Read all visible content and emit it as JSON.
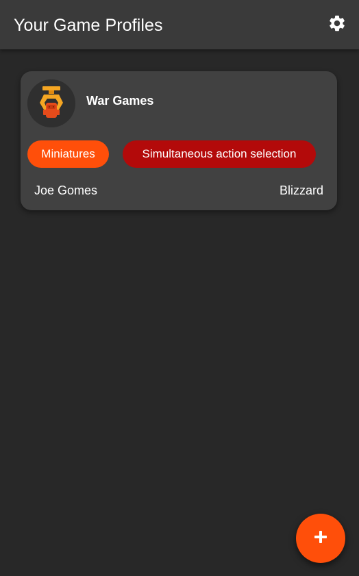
{
  "appbar": {
    "title": "Your Game Profiles",
    "settings_icon": "gear-icon"
  },
  "games": [
    {
      "title": "War Games",
      "avatar_icon": "medal-crane-icon",
      "tags": [
        {
          "label": "Miniatures",
          "color": "#ff4f0a"
        },
        {
          "label": "Simultaneous action selection",
          "color": "#b30a0a"
        }
      ],
      "designer": "Joe Gomes",
      "publisher": "Blizzard"
    }
  ],
  "fab": {
    "icon": "plus-icon",
    "color": "#ff4f0a"
  },
  "colors": {
    "background": "#282828",
    "appbar": "#3a3a3a",
    "card": "#414141",
    "accent": "#ff4f0a",
    "tag_secondary": "#b30a0a"
  }
}
